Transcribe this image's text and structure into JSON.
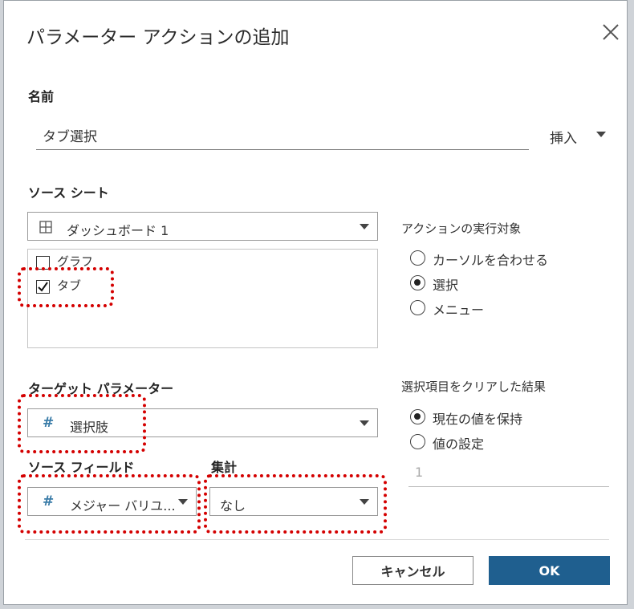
{
  "dialog": {
    "title": "パラメーター アクションの追加"
  },
  "name_section": {
    "label": "名前",
    "value": "タブ選択",
    "insert_label": "挿入"
  },
  "source_sheet": {
    "label": "ソース シート",
    "dashboard": "ダッシュボード 1",
    "sheets": [
      {
        "label": "グラフ",
        "checked": false
      },
      {
        "label": "タブ",
        "checked": true
      }
    ]
  },
  "run_on": {
    "label": "アクションの実行対象",
    "options": [
      {
        "label": "カーソルを合わせる",
        "selected": false
      },
      {
        "label": "選択",
        "selected": true
      },
      {
        "label": "メニュー",
        "selected": false
      }
    ]
  },
  "target_parameter": {
    "label": "ターゲット パラメーター",
    "value": "選択肢"
  },
  "clear_result": {
    "label": "選択項目をクリアした結果",
    "options": [
      {
        "label": "現在の値を保持",
        "selected": true
      },
      {
        "label": "値の設定",
        "selected": false
      }
    ],
    "value": "1"
  },
  "source_field": {
    "label": "ソース フィールド",
    "value": "メジャー バリユ..."
  },
  "aggregation": {
    "label": "集計",
    "value": "なし"
  },
  "buttons": {
    "cancel": "キャンセル",
    "ok": "OK"
  },
  "colors": {
    "highlight": "#d40000",
    "primary": "#1f5f8f",
    "field_icon": "#3a7ca8"
  }
}
